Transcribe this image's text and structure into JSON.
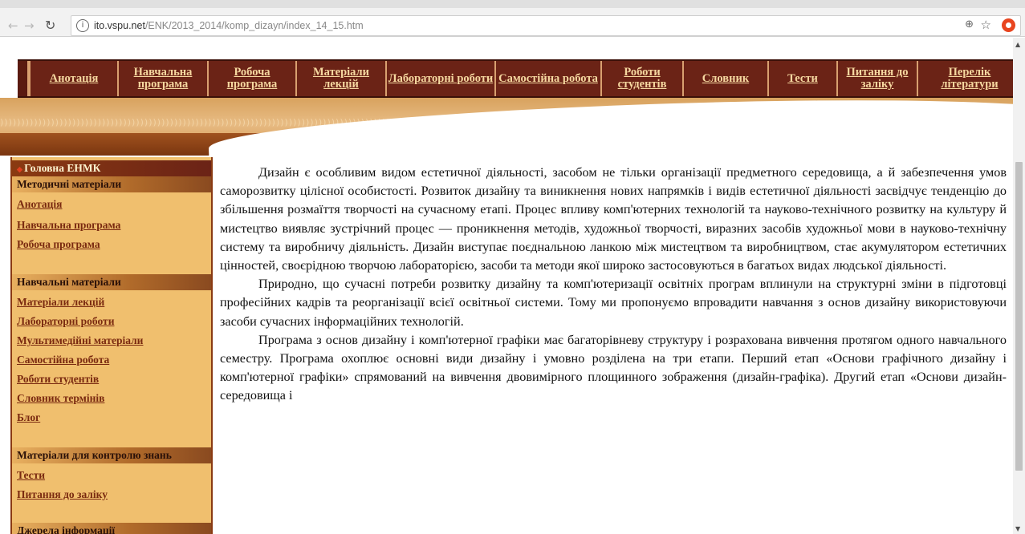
{
  "browser": {
    "url_host": "ito.vspu.net",
    "url_path": "/ENK/2013_2014/komp_dizayn/index_14_15.htm",
    "back_icon": "arrow-left-icon",
    "forward_icon": "arrow-right-icon",
    "reload_icon": "reload-icon",
    "zoom_icon": "zoom-icon",
    "star_icon": "star-icon",
    "extension_icon": "opera-extension-icon"
  },
  "topnav": [
    {
      "label": "Анотація"
    },
    {
      "label": "Навчальна програма"
    },
    {
      "label": "Робоча програма"
    },
    {
      "label": "Матеріали лекцій"
    },
    {
      "label": "Лабораторні роботи"
    },
    {
      "label": "Самостійна робота"
    },
    {
      "label": "Роботи студентів"
    },
    {
      "label": "Словник"
    },
    {
      "label": "Тести"
    },
    {
      "label": "Питання до заліку"
    },
    {
      "label": "Перелік літератури"
    }
  ],
  "sidebar": {
    "main_head": "Головна ЕНМК",
    "section1": {
      "title": "Методичні матеріали",
      "links": [
        "Анотація",
        "Навчальна програма",
        "Робоча програма"
      ]
    },
    "section2": {
      "title": "Навчальні матеріали",
      "links": [
        "Матеріали лекцій",
        "Лабораторні роботи",
        "Мультимедійні матеріали",
        "Самостійна робота",
        "Роботи студентів",
        "Словник термінів",
        "Блог"
      ]
    },
    "section3": {
      "title": "Матеріали для контролю знань",
      "links": [
        "Тести",
        "Питання до заліку"
      ]
    },
    "section4": {
      "title": "Джерела інформації"
    }
  },
  "content": {
    "paragraphs": [
      "Дизайн є особливим видом естетичної діяльності, засобом не тільки організації предметного середовища, а й забезпечення умов саморозвитку цілісної особистості. Розвиток дизайну та виникнення нових напрямків і видів естетичної діяльності засвідчує тенденцію до збільшення розмаїття творчості на сучасному етапі. Процес впливу комп'ютерних технологій та науково-технічного розвитку на культуру й мистецтво виявляє зустрічний процес — проникнення методів, художньої творчості, виразних засобів художньої мови в науково-технічну систему та виробничу діяльність. Дизайн виступає поєднальною ланкою між мистецтвом та виробництвом, стає акумулятором естетичних цінностей, своєрідною творчою лабораторією, засоби та методи якої широко застосовуються в багатьох видах людської діяльності.",
      "Природно, що сучасні потреби розвитку дизайну та комп'ютеризації освітніх програм вплинули на структурні зміни в підготовці професійних кадрів та реорганізації всієї освітньої системи. Тому ми пропонуємо впровадити навчання з основ дизайну використовуючи засоби сучасних інформаційних технологій.",
      "Програма з основ дизайну і комп'ютерної графіки має багаторівневу структуру і розрахована вивчення протягом одного навчального семестру. Програма охоплює основні види дизайну і умовно розділена на три етапи. Перший етап «Основи графічного дизайну і комп'ютерної графіки» спрямований на вивчення двовимірного площинного зображення (дизайн-графіка). Другий етап «Основи дизайн-середовища і"
    ]
  }
}
